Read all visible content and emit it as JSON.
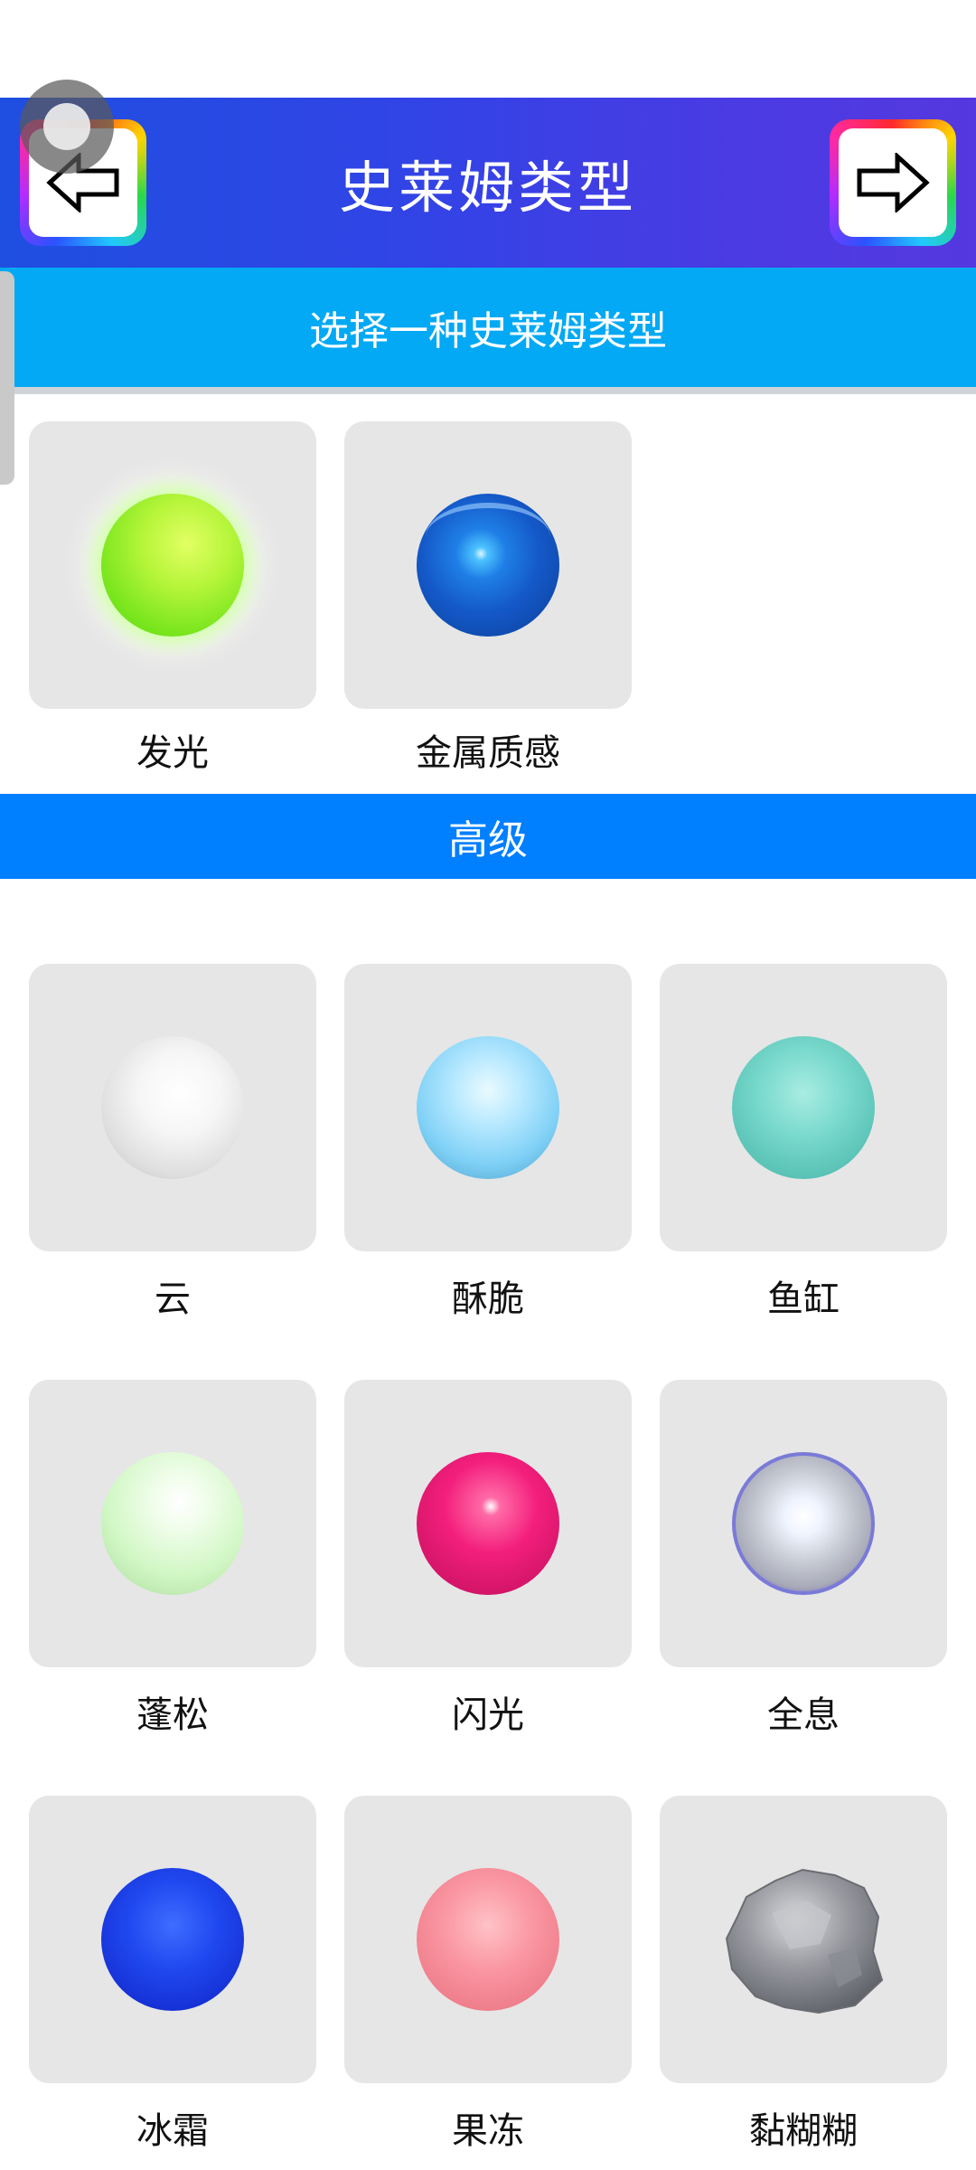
{
  "header": {
    "title": "史莱姆类型",
    "back_icon": "arrow-left-icon",
    "next_icon": "arrow-right-icon"
  },
  "subheader": {
    "text": "选择一种史莱姆类型"
  },
  "basic_items": [
    {
      "label": "发光",
      "icon": "glowing-green-sphere"
    },
    {
      "label": "金属质感",
      "icon": "metallic-blue-sphere"
    }
  ],
  "section": {
    "title": "高级"
  },
  "advanced_items": [
    {
      "label": "云",
      "icon": "white-cloud-sphere"
    },
    {
      "label": "酥脆",
      "icon": "light-blue-crispy-sphere"
    },
    {
      "label": "鱼缸",
      "icon": "teal-sphere"
    },
    {
      "label": "蓬松",
      "icon": "pale-green-fluffy-sphere"
    },
    {
      "label": "闪光",
      "icon": "pink-glitter-sphere"
    },
    {
      "label": "全息",
      "icon": "holographic-sphere"
    },
    {
      "label": "冰霜",
      "icon": "blue-frost-sphere"
    },
    {
      "label": "果冻",
      "icon": "pink-jelly-sphere"
    },
    {
      "label": "黏糊糊",
      "icon": "grey-goo-blob"
    }
  ],
  "colors": {
    "header_gradient_start": "#1e4fe0",
    "header_gradient_end": "#5538df",
    "subheader": "#03a9f4",
    "section_bar": "#007fff",
    "card_bg": "#e6e6e6"
  }
}
